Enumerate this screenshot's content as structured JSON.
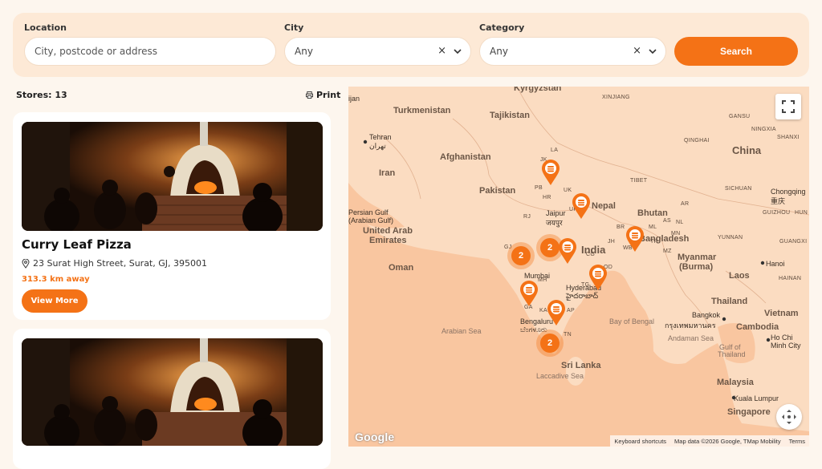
{
  "filters": {
    "location": {
      "label": "Location",
      "placeholder": "City, postcode or address"
    },
    "city": {
      "label": "City",
      "value": "Any"
    },
    "category": {
      "label": "Category",
      "value": "Any"
    },
    "clear_glyph": "×",
    "search_label": "Search"
  },
  "list": {
    "stores_count": "Stores: 13",
    "print_label": "Print"
  },
  "stores": [
    {
      "name": "Curry Leaf Pizza",
      "address": "23 Surat High Street, Surat, GJ, 395001",
      "distance": "313.3 km away",
      "button": "View More"
    },
    {
      "name": "",
      "address": "",
      "distance": "",
      "button": ""
    }
  ],
  "map": {
    "labels": {
      "kyrgyzstan": "Kyrgyzstan",
      "xinjiang": "XINJIANG",
      "turkmenistan": "Turkmenistan",
      "tajikistan": "Tajikistan",
      "gansu": "GANSU",
      "ningxia": "NINGXIA",
      "shanxi": "SHANXI",
      "tehran": "Tehran",
      "tehran_native": "تهران",
      "qinghai": "QINGHAI",
      "china": "China",
      "afghanistan": "Afghanistan",
      "iran": "Iran",
      "tibet": "TIBET",
      "pakistan": "Pakistan",
      "sichuan": "SICHUAN",
      "chongqing": "Chongqing",
      "chongqing_native": "重庆",
      "nepal": "Nepal",
      "jaipur": "Jaipur",
      "jaipur_native": "जयपुर",
      "guizhou": "GUIZHOU",
      "hun": "HUN",
      "persian_gulf": "Persian Gulf",
      "arabian_gulf": "(Arabian Gulf)",
      "bhutan": "Bhutan",
      "uae_1": "United Arab",
      "uae_2": "Emirates",
      "bangladesh": "Bangladesh",
      "yunnan": "YUNNAN",
      "guangxi": "GUANGXI",
      "india": "India",
      "oman": "Oman",
      "myanmar_1": "Myanmar",
      "myanmar_2": "(Burma)",
      "hanoi": "Hanoi",
      "mumbai": "Mumbai",
      "laos": "Laos",
      "hainan": "HAINAN",
      "hyderabad": "Hyderabad",
      "hyderabad_native": "హైదరాబాద్",
      "thailand": "Thailand",
      "vietnam": "Vietnam",
      "bangkok": "Bangkok",
      "bangkok_native": "กรุงเทพมหานคร",
      "bengaluru": "Bengaluru",
      "bengaluru_native": "ಬೆಂಗಳೂರು",
      "arabian_sea": "Arabian Sea",
      "bay_of_bengal": "Bay of Bengal",
      "cambodia": "Cambodia",
      "andaman_sea": "Andaman Sea",
      "ho_chi_minh_1": "Ho Chi",
      "ho_chi_minh_2": "Minh City",
      "gulf_thailand_1": "Gulf of",
      "gulf_thailand_2": "Thailand",
      "sri_lanka": "Sri Lanka",
      "laccadive_sea": "Laccadive Sea",
      "malaysia": "Malaysia",
      "kuala_lumpur": "Kuala Lumpur",
      "singapore": "Singapore",
      "ijan": "ijan",
      "state_la": "LA",
      "state_jk": "JK",
      "state_pb": "PB",
      "state_hr": "HR",
      "state_uk": "UK",
      "state_rj": "RJ",
      "state_up": "UP",
      "state_jh": "JH",
      "state_wb": "WB",
      "state_ml": "ML",
      "state_as": "AS",
      "state_ar": "AR",
      "state_nl": "NL",
      "state_mn": "MN",
      "state_mz": "MZ",
      "state_tr": "TR",
      "state_br": "BR",
      "state_gj": "GJ",
      "state_mh": "MH",
      "state_cg": "CG",
      "state_od": "OD",
      "state_tg": "TG",
      "state_ap": "AP",
      "state_ga": "GA",
      "state_ka": "KA",
      "state_tn": "TN",
      "state_kl": "KL"
    },
    "clusters": [
      "2",
      "2",
      "2"
    ],
    "google": "Google",
    "attribution": {
      "shortcuts": "Keyboard shortcuts",
      "data": "Map data ©2026 Google, TMap Mobility",
      "terms": "Terms"
    }
  },
  "colors": {
    "accent": "#f47216",
    "filter_bg": "#fde9d6",
    "map_land": "#fbdcc1",
    "map_water": "#f9c6a0"
  }
}
